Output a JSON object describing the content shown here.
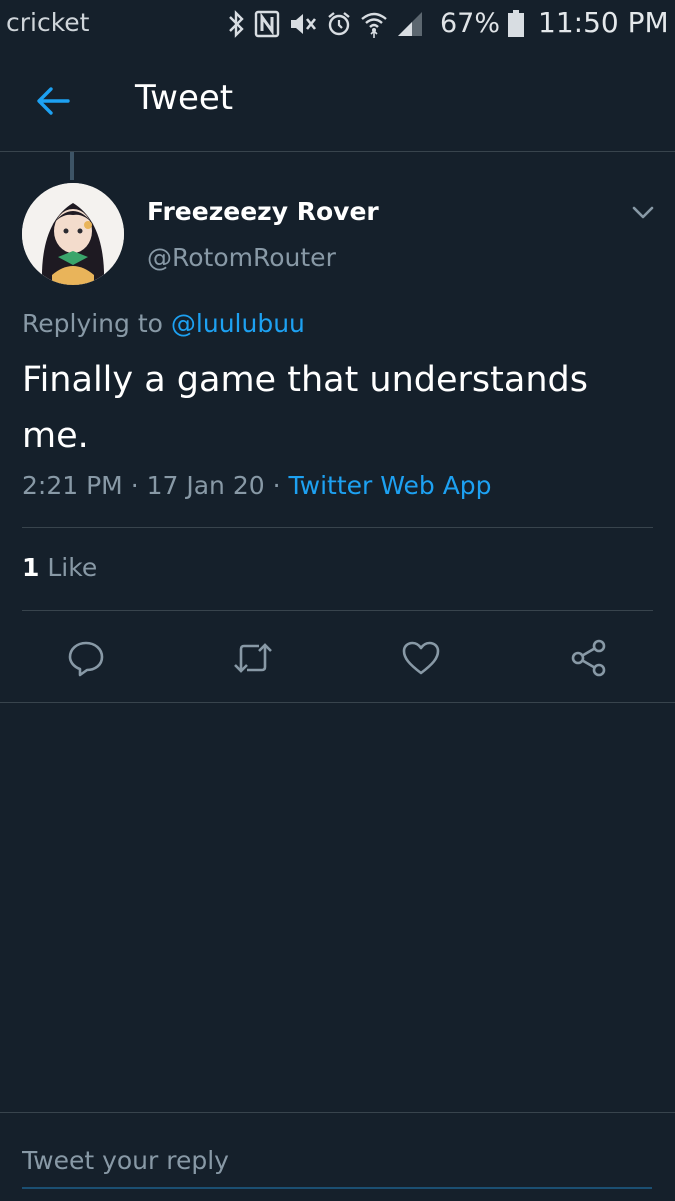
{
  "status_bar": {
    "carrier": "cricket",
    "battery_percent": "67%",
    "time": "11:50 PM",
    "icons": [
      "bluetooth-icon",
      "nfc-icon",
      "mute-icon",
      "alarm-icon",
      "wifi-icon",
      "signal-icon",
      "battery-icon"
    ]
  },
  "header": {
    "title": "Tweet",
    "back_icon": "back-arrow-icon"
  },
  "tweet": {
    "display_name": "Freezeezy Rover",
    "handle": "@RotomRouter",
    "replying_prefix": "Replying to",
    "replying_to": "@luulubuu",
    "text": "Finally a game that understands me.",
    "time": "2:21 PM",
    "date": "17 Jan 20",
    "separator": "·",
    "source": "Twitter Web App",
    "likes_count": "1",
    "likes_label": "Like"
  },
  "actions": [
    "reply-icon",
    "retweet-icon",
    "like-icon",
    "share-icon"
  ],
  "reply_bar": {
    "placeholder": "Tweet your reply"
  },
  "colors": {
    "background": "#15202b",
    "accent": "#1da1f2",
    "secondary_text": "#8899a6",
    "divider": "#38444d"
  }
}
